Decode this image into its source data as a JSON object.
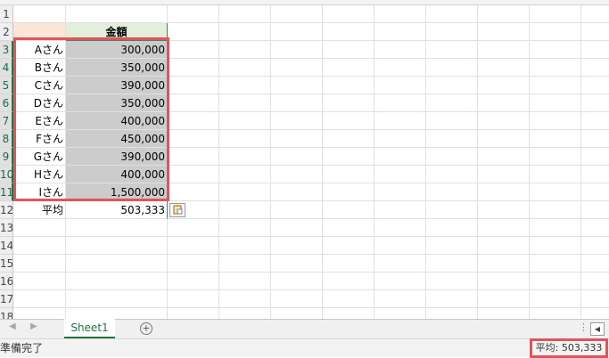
{
  "spreadsheet": {
    "header": "金額",
    "rows": [
      {
        "row": "1",
        "name": "",
        "amount": ""
      },
      {
        "row": "2",
        "name": "",
        "amount": ""
      },
      {
        "row": "3",
        "name": "Aさん",
        "amount": "300,000"
      },
      {
        "row": "4",
        "name": "Bさん",
        "amount": "350,000"
      },
      {
        "row": "5",
        "name": "Cさん",
        "amount": "390,000"
      },
      {
        "row": "6",
        "name": "Dさん",
        "amount": "350,000"
      },
      {
        "row": "7",
        "name": "Eさん",
        "amount": "400,000"
      },
      {
        "row": "8",
        "name": "Fさん",
        "amount": "450,000"
      },
      {
        "row": "9",
        "name": "Gさん",
        "amount": "390,000"
      },
      {
        "row": "10",
        "name": "Hさん",
        "amount": "400,000"
      },
      {
        "row": "11",
        "name": "Iさん",
        "amount": "1,500,000"
      },
      {
        "row": "12",
        "name": "平均",
        "amount": "503,333"
      },
      {
        "row": "13",
        "name": "",
        "amount": ""
      },
      {
        "row": "14",
        "name": "",
        "amount": ""
      },
      {
        "row": "15",
        "name": "",
        "amount": ""
      },
      {
        "row": "16",
        "name": "",
        "amount": ""
      },
      {
        "row": "17",
        "name": "",
        "amount": ""
      },
      {
        "row": "18",
        "name": "",
        "amount": ""
      }
    ]
  },
  "sheet_tabs": {
    "active": "Sheet1",
    "add_symbol": "+",
    "prev_symbol": "◀",
    "next_symbol": "▶",
    "scroll_left_symbol": "◀",
    "options_symbol": "⋮"
  },
  "status_bar": {
    "ready": "準備完了",
    "average": "平均: 503,333"
  },
  "colors": {
    "highlight_border": "#e2545d",
    "header_fill": "#e2efda",
    "name_header_fill": "#fce4d6",
    "selected_fill": "#cccccc",
    "tab_accent": "#217346"
  },
  "icons": {
    "paste_options": "paste-options-icon"
  }
}
